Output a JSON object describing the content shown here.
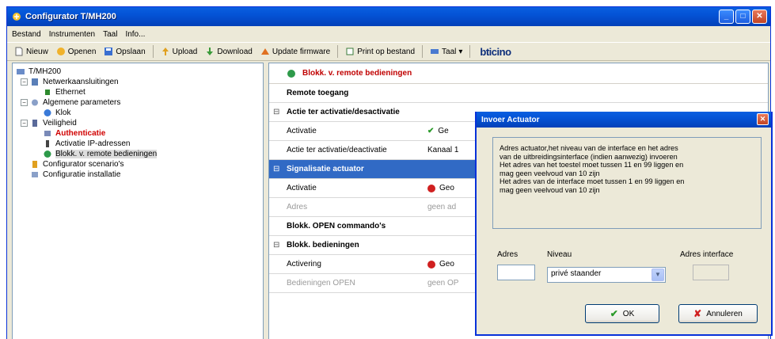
{
  "window": {
    "title": "Configurator T/MH200"
  },
  "menu": [
    "Bestand",
    "Instrumenten",
    "Taal",
    "Info..."
  ],
  "toolbar": {
    "new": "Nieuw",
    "open": "Openen",
    "save": "Opslaan",
    "upload": "Upload",
    "download": "Download",
    "update_firmware": "Update firmware",
    "print": "Print op bestand",
    "language": "Taal",
    "brand_main": "bticino",
    "brand_accent": ""
  },
  "tree": {
    "root": "T/MH200",
    "items": [
      {
        "label": "Netwerkaansluitingen"
      },
      {
        "label": "Ethernet"
      },
      {
        "label": "Algemene parameters"
      },
      {
        "label": "Klok"
      },
      {
        "label": "Veiligheid"
      },
      {
        "label": "Authenticatie"
      },
      {
        "label": "Activatie IP-adressen"
      },
      {
        "label": "Blokk. v. remote bedieningen"
      },
      {
        "label": "Configurator scenario's"
      },
      {
        "label": "Configuratie installatie"
      }
    ]
  },
  "main": {
    "header": "Blokk. v. remote bedieningen",
    "rows": [
      {
        "c1": "Remote toegang",
        "c2": ""
      },
      {
        "c1": "Actie ter activatie/desactivatie",
        "c2": ""
      },
      {
        "c1": "Activatie",
        "c2": "Ge"
      },
      {
        "c1": "Actie ter activatie/deactivatie",
        "c2": "Kanaal 1"
      },
      {
        "c1": "Signalisatie actuator",
        "c2": ""
      },
      {
        "c1": "Activatie",
        "c2": "Geo"
      },
      {
        "c1": "Adres",
        "c2": "geen ad"
      },
      {
        "c1": "Blokk. OPEN commando's",
        "c2": ""
      },
      {
        "c1": "Blokk. bedieningen",
        "c2": ""
      },
      {
        "c1": "Activering",
        "c2": "Geo"
      },
      {
        "c1": "Bedieningen OPEN",
        "c2": "geen OP"
      }
    ]
  },
  "dialog": {
    "title": "Invoer Actuator",
    "message": [
      "Adres actuator,het niveau van de interface en het adres",
      "van de uitbreidingsinterface (indien aanwezig) invoeren",
      "Het adres van het toestel moet tussen  11 en 99 liggen en",
      "mag geen veelvoud van 10 zijn",
      "Het adres van de interface moet tussen 1 en 99 liggen en",
      "mag geen veelvoud van 10 zijn"
    ],
    "adres_label": "Adres",
    "niveau_label": "Niveau",
    "interface_label": "Adres interface",
    "adres_value": "",
    "niveau_value": "privé staander",
    "interface_value": "",
    "ok": "OK",
    "cancel": "Annuleren"
  },
  "colors": {
    "titlebar": "#0453d6",
    "selection": "#316ac5",
    "red_text": "#d00000"
  }
}
